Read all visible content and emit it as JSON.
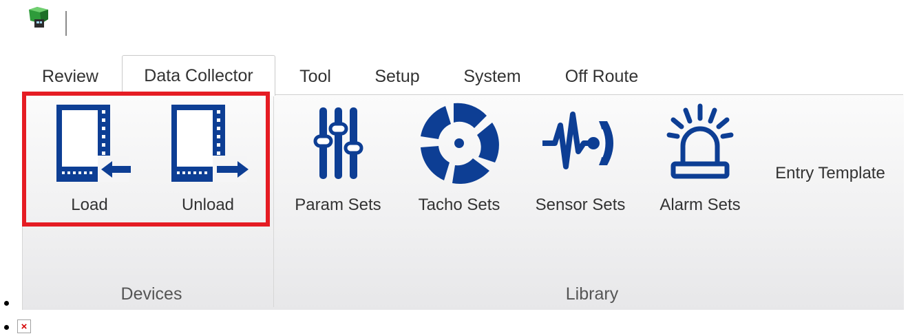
{
  "tabs": [
    {
      "label": "Review",
      "active": false
    },
    {
      "label": "Data Collector",
      "active": true
    },
    {
      "label": "Tool",
      "active": false
    },
    {
      "label": "Setup",
      "active": false
    },
    {
      "label": "System",
      "active": false
    },
    {
      "label": "Off Route",
      "active": false
    }
  ],
  "groups": {
    "devices": {
      "label": "Devices",
      "buttons": [
        {
          "label": "Load",
          "icon": "device-load-icon"
        },
        {
          "label": "Unload",
          "icon": "device-unload-icon"
        }
      ]
    },
    "library": {
      "label": "Library",
      "buttons": [
        {
          "label": "Param Sets",
          "icon": "sliders-icon"
        },
        {
          "label": "Tacho Sets",
          "icon": "tacho-icon"
        },
        {
          "label": "Sensor Sets",
          "icon": "sensor-icon"
        },
        {
          "label": "Alarm Sets",
          "icon": "alarm-icon"
        },
        {
          "label": "Entry Template",
          "icon": "none"
        }
      ]
    }
  },
  "colors": {
    "icon_blue": "#0d3e94",
    "highlight_red": "#e51c23",
    "logo_green": "#2e9b3a"
  }
}
